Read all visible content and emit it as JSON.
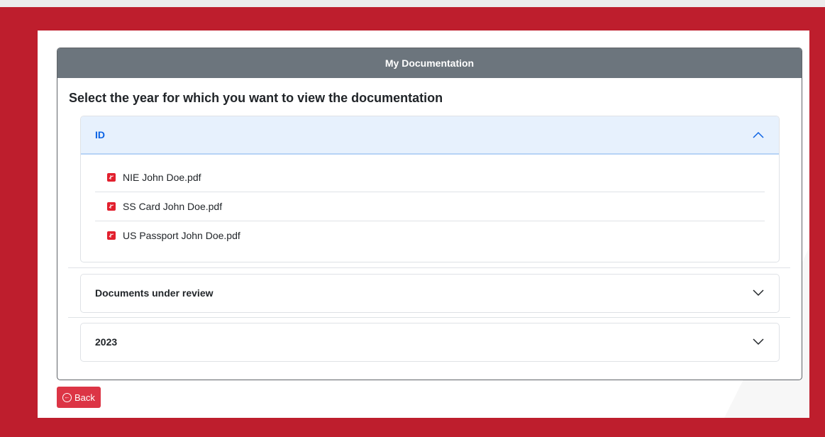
{
  "card": {
    "title": "My Documentation"
  },
  "prompt": "Select the year for which you want to view the documentation",
  "accordion": [
    {
      "label": "ID",
      "expanded": true,
      "documents": [
        "NIE John Doe.pdf",
        "SS Card John Doe.pdf",
        "US Passport John Doe.pdf"
      ]
    },
    {
      "label": "Documents under review",
      "expanded": false
    },
    {
      "label": "2023",
      "expanded": false
    }
  ],
  "back_button": {
    "label": "Back"
  },
  "colors": {
    "frame": "#be1e2d",
    "header": "#6c757d",
    "accent_blue": "#0c63e4",
    "pdf_red": "#e2202e",
    "button_red": "#dc3545"
  },
  "icons": {
    "document": "pdf-file-icon",
    "expanded": "chevron-up-icon",
    "collapsed": "chevron-down-icon",
    "back": "arrow-left-circle-icon"
  }
}
